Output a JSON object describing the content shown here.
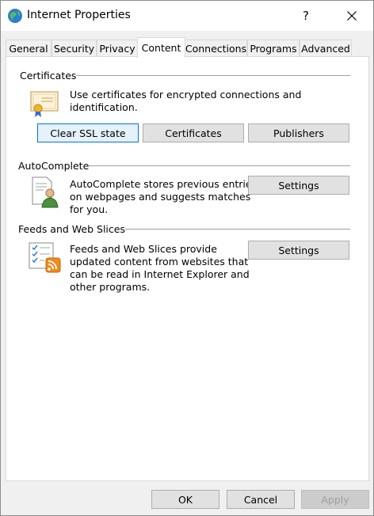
{
  "window": {
    "title": "Internet Properties",
    "help": "?",
    "close": "✕"
  },
  "tabs": [
    "General",
    "Security",
    "Privacy",
    "Content",
    "Connections",
    "Programs",
    "Advanced"
  ],
  "active_tab": "Content",
  "certificates": {
    "label": "Certificates",
    "description": "Use certificates for encrypted connections and identification.",
    "buttons": {
      "clear_ssl": "Clear SSL state",
      "certificates": "Certificates",
      "publishers": "Publishers"
    }
  },
  "autocomplete": {
    "label": "AutoComplete",
    "description_lines": [
      "AutoComplete stores previous entries",
      "on webpages and suggests matches",
      "for you."
    ],
    "settings": "Settings"
  },
  "feeds": {
    "label": "Feeds and Web Slices",
    "description_lines": [
      "Feeds and Web Slices provide",
      "updated content from websites that",
      "can be read in Internet Explorer and",
      "other programs."
    ],
    "settings": "Settings"
  },
  "footer": {
    "ok": "OK",
    "cancel": "Cancel",
    "apply": "Apply"
  }
}
